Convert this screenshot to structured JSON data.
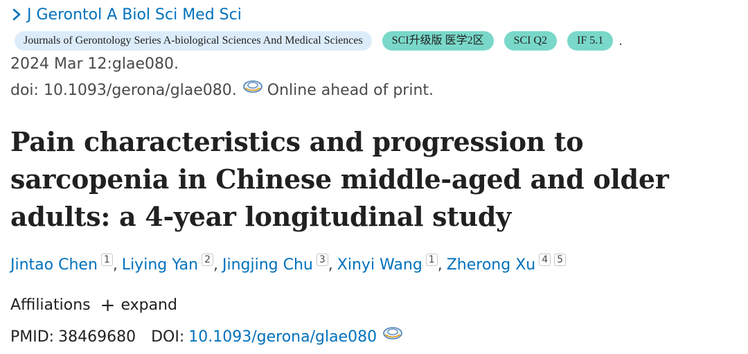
{
  "journal": {
    "abbrev": "J Gerontol A Biol Sci Med Sci",
    "full_name": "Journals of Gerontology Series A-biological Sciences And Medical Sciences",
    "tags": [
      "SCI升级版 医学2区",
      "SCI Q2",
      "IF 5.1"
    ],
    "trailing": ".",
    "icons": {
      "chevron": "chevron-right-icon"
    }
  },
  "citation": {
    "date": "2024 Mar 12:glae080.",
    "doi_text": "doi: 10.1093/gerona/glae080.",
    "status": "Online ahead of print.",
    "icon": "doi-tracker-icon"
  },
  "article": {
    "title": "Pain characteristics and progression to sarcopenia in Chinese middle-aged and older adults: a 4-year longitudinal study"
  },
  "authors": [
    {
      "name": "Jintao Chen",
      "affs": [
        "1"
      ]
    },
    {
      "name": "Liying Yan",
      "affs": [
        "2"
      ]
    },
    {
      "name": "Jingjing Chu",
      "affs": [
        "3"
      ]
    },
    {
      "name": "Xinyi Wang",
      "affs": [
        "1"
      ]
    },
    {
      "name": "Zherong Xu",
      "affs": [
        "4",
        "5"
      ]
    }
  ],
  "affiliations": {
    "label": "Affiliations",
    "expand_label": "expand",
    "icon": "plus-icon"
  },
  "ids": {
    "pmid_label": "PMID:",
    "pmid": "38469680",
    "doi_label": "DOI:",
    "doi": "10.1093/gerona/glae080",
    "icon": "doi-tracker-icon"
  },
  "colors": {
    "link": "#0071bc",
    "journal_badge_bg": "#dcecfa",
    "tag_badge_bg": "#79d8c9",
    "text": "#212121",
    "muted_text": "#4a4a4a"
  }
}
